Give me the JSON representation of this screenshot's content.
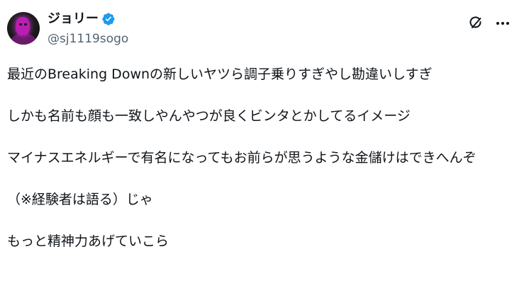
{
  "author": {
    "display_name": "ジョリー",
    "handle": "@sj1119sogo",
    "verified": true,
    "verified_color": "#1d9bf0"
  },
  "actions": {
    "grok_icon": "grok-icon",
    "more_icon": "more-icon"
  },
  "tweet": {
    "lines": [
      "最近のBreaking Downの新しいヤツら調子乗りすぎやし勘違いしすぎ",
      "しかも名前も顔も一致しやんやつが良くビンタとかしてるイメージ",
      "マイナスエネルギーで有名になってもお前らが思うような金儲けはできへんぞ",
      "（※経験者は語る）じゃ",
      "もっと精神力あげていこら"
    ]
  },
  "colors": {
    "text": "#0f1419",
    "secondary_text": "#536471",
    "background": "#ffffff"
  }
}
